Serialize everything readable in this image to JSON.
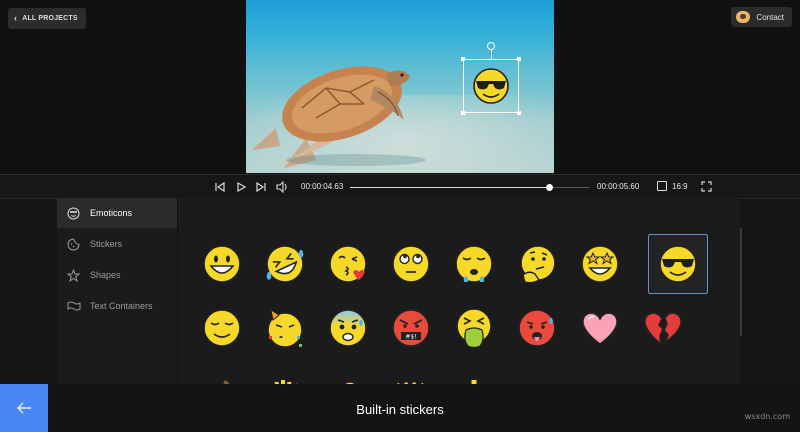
{
  "topbar": {
    "back_label": "ALL PROJECTS",
    "contact_label": "Contact"
  },
  "player": {
    "current_time": "00:00:04.63",
    "total_time": "00:00:05.60",
    "progress_fraction": 0.83,
    "aspect_ratio": "16:9"
  },
  "sidebar": {
    "items": [
      {
        "label": "Emoticons",
        "icon": "emoticon-icon",
        "active": true
      },
      {
        "label": "Stickers",
        "icon": "sticker-icon",
        "active": false
      },
      {
        "label": "Shapes",
        "icon": "star-icon",
        "active": false
      },
      {
        "label": "Text Containers",
        "icon": "text-container-icon",
        "active": false
      }
    ]
  },
  "stickers": {
    "row1": [
      "grinning",
      "rolling-laughing",
      "kissing-heart",
      "eye-roll",
      "crying",
      "thinking",
      "star-struck",
      "sunglasses"
    ],
    "row2": [
      "relieved",
      "party",
      "anxious",
      "cursing",
      "vomiting",
      "hot-face",
      "pink-heart",
      "broken-heart"
    ],
    "selected": "sunglasses"
  },
  "footer": {
    "caption": "Built-in stickers",
    "watermark": "wsxdn.com"
  },
  "colors": {
    "accent": "#4a86f5",
    "emoji_yellow": "#f6d928",
    "selected_border": "#6d8dd0"
  }
}
